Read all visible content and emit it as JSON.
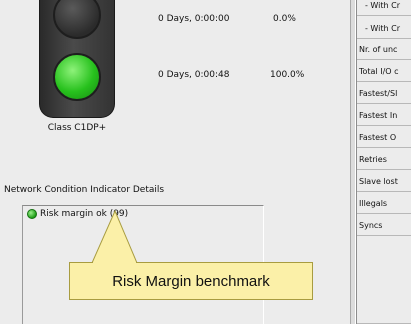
{
  "traffic_light": {
    "class_label": "Class C1DP+",
    "rows": [
      {
        "duration": "0 Days, 0:00:00",
        "percent": "0.0%"
      },
      {
        "duration": "0 Days, 0:00:48",
        "percent": "100.0%"
      }
    ],
    "active_color": "#27c11d"
  },
  "details": {
    "section_title": "Network Condition Indicator Details",
    "items": [
      {
        "label": "Risk margin ok (99)",
        "status_color": "#1f9e17"
      }
    ]
  },
  "side_list": {
    "rows": [
      {
        "label": "- With Cr",
        "inset": true
      },
      {
        "label": "- With Cr",
        "inset": true
      },
      {
        "label": "Nr. of unc"
      },
      {
        "label": "Total I/O c"
      },
      {
        "label": "Fastest/Sl"
      },
      {
        "label": "Fastest In"
      },
      {
        "label": "Fastest O"
      },
      {
        "label": "Retries"
      },
      {
        "label": "Slave lost"
      },
      {
        "label": "Illegals"
      },
      {
        "label": "Syncs"
      }
    ]
  },
  "callout": {
    "text": "Risk Margin benchmark",
    "color": "#fbf0a8"
  }
}
